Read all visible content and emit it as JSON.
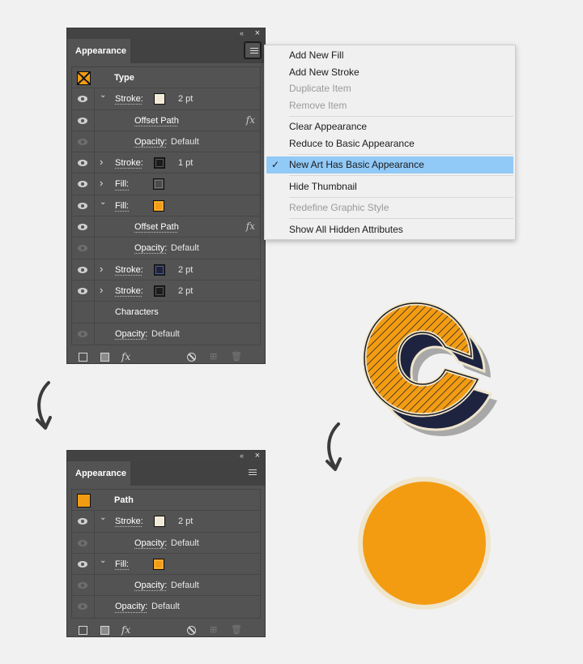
{
  "panel_top": {
    "tab": "Appearance",
    "head_label": "Type",
    "rows": [
      {
        "type": "stroke",
        "label": "Stroke:",
        "value": "2 pt",
        "expanded": true,
        "color": "#f0e9d6"
      },
      {
        "type": "effect",
        "label": "Offset Path"
      },
      {
        "type": "opacity",
        "label": "Opacity:",
        "value": "Default"
      },
      {
        "type": "stroke",
        "label": "Stroke:",
        "value": "1 pt",
        "expanded": false,
        "color": "#1c1c1c"
      },
      {
        "type": "fill",
        "label": "Fill:",
        "expanded": false,
        "color": "#4a4a4a"
      },
      {
        "type": "fill",
        "label": "Fill:",
        "expanded": true,
        "color": "#f39c12"
      },
      {
        "type": "effect",
        "label": "Offset Path"
      },
      {
        "type": "opacity",
        "label": "Opacity:",
        "value": "Default"
      },
      {
        "type": "stroke",
        "label": "Stroke:",
        "value": "2 pt",
        "expanded": false,
        "color": "#1e2340"
      },
      {
        "type": "stroke",
        "label": "Stroke:",
        "value": "2 pt",
        "expanded": false,
        "color": "#1c1c1c"
      },
      {
        "type": "characters",
        "label": "Characters"
      },
      {
        "type": "opacity_main",
        "label": "Opacity:",
        "value": "Default"
      }
    ],
    "fx_label": "fx"
  },
  "panel_bottom": {
    "tab": "Appearance",
    "head_label": "Path",
    "rows": [
      {
        "type": "stroke",
        "label": "Stroke:",
        "value": "2 pt",
        "expanded": true,
        "color": "#f0e9d6"
      },
      {
        "type": "opacity",
        "label": "Opacity:",
        "value": "Default"
      },
      {
        "type": "fill",
        "label": "Fill:",
        "expanded": true,
        "color": "#f39c12"
      },
      {
        "type": "opacity",
        "label": "Opacity:",
        "value": "Default"
      },
      {
        "type": "opacity_main",
        "label": "Opacity:",
        "value": "Default"
      }
    ],
    "fx_label": "fx"
  },
  "flyout_menu": {
    "groups": [
      [
        {
          "label": "Add New Fill",
          "enabled": true
        },
        {
          "label": "Add New Stroke",
          "enabled": true
        },
        {
          "label": "Duplicate Item",
          "enabled": false
        },
        {
          "label": "Remove Item",
          "enabled": false
        }
      ],
      [
        {
          "label": "Clear Appearance",
          "enabled": true
        },
        {
          "label": "Reduce to Basic Appearance",
          "enabled": true
        }
      ],
      [
        {
          "label": "New Art Has Basic Appearance",
          "enabled": true,
          "checked": true,
          "highlighted": true
        }
      ],
      [
        {
          "label": "Hide Thumbnail",
          "enabled": true
        }
      ],
      [
        {
          "label": "Redefine Graphic Style",
          "enabled": false
        }
      ],
      [
        {
          "label": "Show All Hidden Attributes",
          "enabled": true
        }
      ]
    ]
  },
  "colors": {
    "orange": "#f39c12",
    "cream": "#efe5cc",
    "navy": "#1e2340",
    "menu_highlight": "#91c9f7",
    "panel_bg": "#535353"
  },
  "icons": {
    "panel_close": "×",
    "panel_collapse": "«",
    "chevron_down": "⌄",
    "chevron_right": "›",
    "checkmark": "✓"
  }
}
